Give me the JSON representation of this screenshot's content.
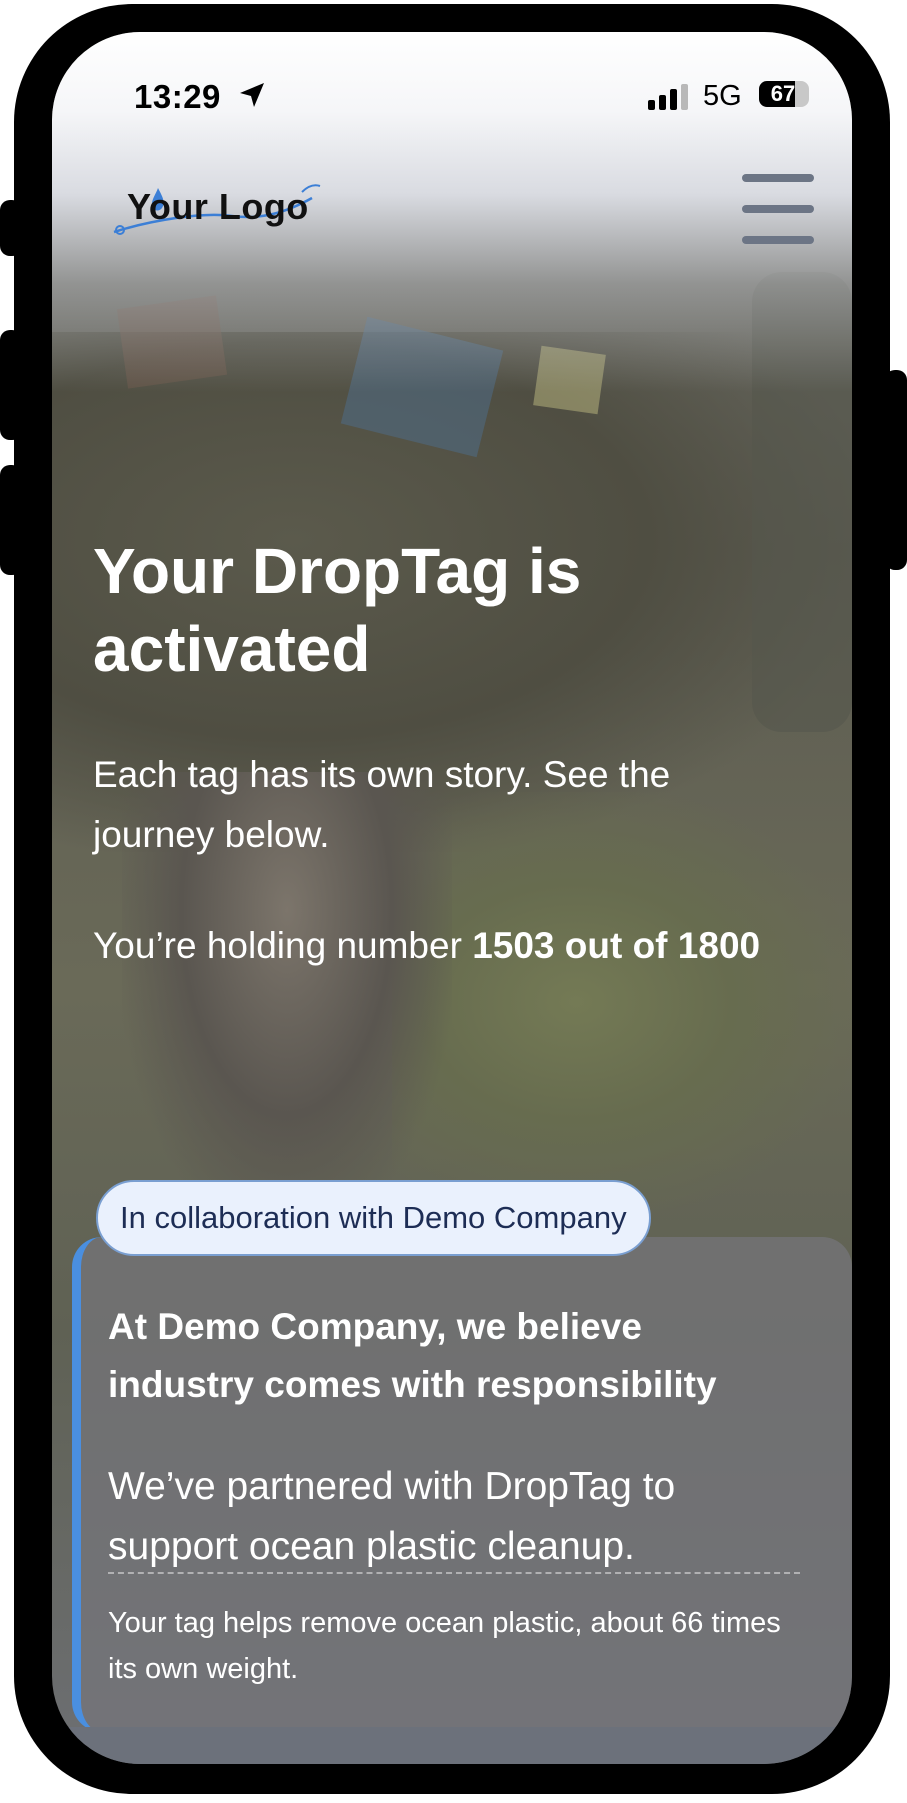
{
  "status_bar": {
    "time": "13:29",
    "network": "5G",
    "battery": "67"
  },
  "header": {
    "logo_text": "Your Logo",
    "menu_icon": "hamburger-menu-icon"
  },
  "hero": {
    "title": "Your DropTag is activated",
    "intro": "Each tag has its own story. See the journey below.",
    "count_prefix": "You’re holding number ",
    "count_value": "1503 out of 1800"
  },
  "collaboration": {
    "badge": "In collaboration with Demo Company",
    "title": "At Demo Company, we believe industry comes with responsibility",
    "body": "We’ve partnered with DropTag to support ocean plastic cleanup.",
    "note": "Your tag helps remove ocean plastic, about 66 times its own weight."
  },
  "colors": {
    "accent": "#4a8fe0",
    "badge_background": "#eaf1fd",
    "badge_text": "#1d2d55",
    "menu": "#6c7585"
  }
}
